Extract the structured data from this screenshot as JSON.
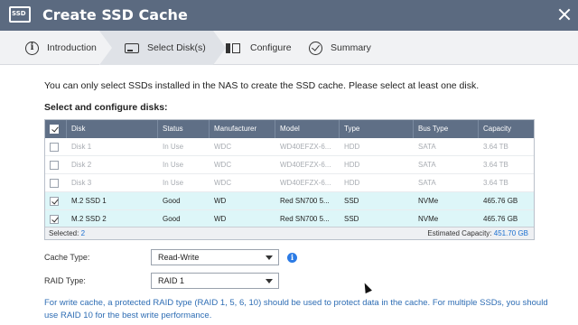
{
  "window": {
    "title": "Create SSD Cache",
    "icon_text": "SSD"
  },
  "steps": [
    {
      "label": "Introduction",
      "icon": "info-circle-icon"
    },
    {
      "label": "Select Disk(s)",
      "icon": "disk-icon"
    },
    {
      "label": "Configure",
      "icon": "configure-icon"
    },
    {
      "label": "Summary",
      "icon": "check-circle-icon"
    }
  ],
  "active_step": "Select Disk(s)",
  "info_text": "You can only select SSDs installed in the NAS to create the SSD cache. Please select at least one disk.",
  "section_title": "Select and configure disks:",
  "table": {
    "columns": [
      "Disk",
      "Status",
      "Manufacturer",
      "Model",
      "Type",
      "Bus Type",
      "Capacity"
    ],
    "rows": [
      {
        "disk": "Disk 1",
        "status": "In Use",
        "manufacturer": "WDC",
        "model": "WD40EFZX-6...",
        "type": "HDD",
        "bus": "SATA",
        "capacity": "3.64 TB",
        "checked": false
      },
      {
        "disk": "Disk 2",
        "status": "In Use",
        "manufacturer": "WDC",
        "model": "WD40EFZX-6...",
        "type": "HDD",
        "bus": "SATA",
        "capacity": "3.64 TB",
        "checked": false
      },
      {
        "disk": "Disk 3",
        "status": "In Use",
        "manufacturer": "WDC",
        "model": "WD40EFZX-6...",
        "type": "HDD",
        "bus": "SATA",
        "capacity": "3.64 TB",
        "checked": false
      },
      {
        "disk": "M.2 SSD 1",
        "status": "Good",
        "manufacturer": "WD",
        "model": "Red SN700 5...",
        "type": "SSD",
        "bus": "NVMe",
        "capacity": "465.76 GB",
        "checked": true
      },
      {
        "disk": "M.2 SSD 2",
        "status": "Good",
        "manufacturer": "WD",
        "model": "Red SN700 5...",
        "type": "SSD",
        "bus": "NVMe",
        "capacity": "465.76 GB",
        "checked": true
      }
    ],
    "header_checked": true,
    "footer": {
      "selected_label": "Selected:",
      "selected_count": "2",
      "capacity_label": "Estimated Capacity:",
      "capacity_value": "451.70 GB"
    }
  },
  "form": {
    "cache_type_label": "Cache Type:",
    "cache_type_value": "Read-Write",
    "raid_type_label": "RAID Type:",
    "raid_type_value": "RAID 1"
  },
  "note": "For write cache, a protected RAID type (RAID 1, 5, 6, 10) should be used to protect data in the cache. For multiple SSDs, you should use RAID 10 for the best write performance.",
  "colors": {
    "titlebar": "#5b6a80",
    "table_header": "#5f6f86",
    "selected_row": "#ddf6f8",
    "link_blue": "#2e6db4"
  }
}
